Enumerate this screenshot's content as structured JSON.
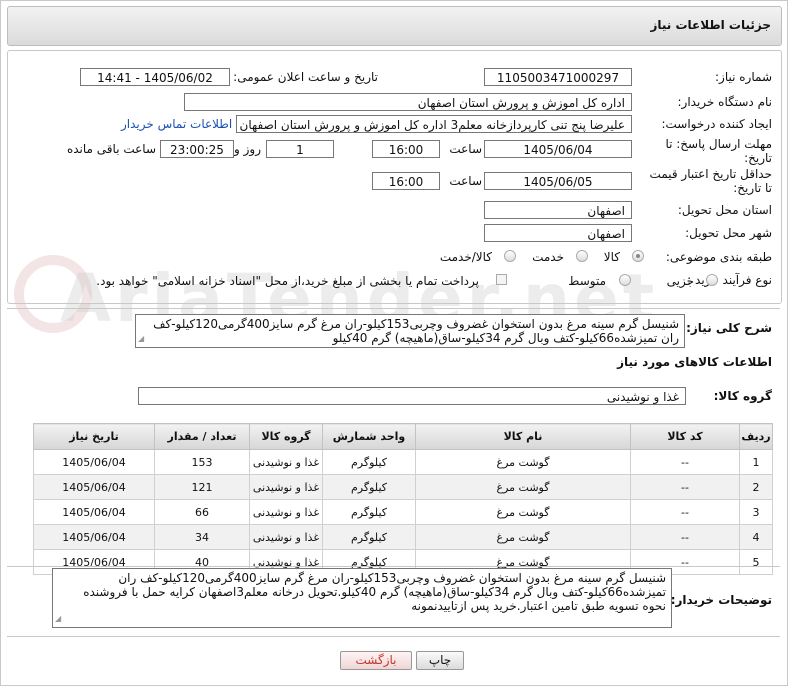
{
  "header": {
    "title": "جزئیات اطلاعات نیاز"
  },
  "form": {
    "need_number_label": "شماره نیاز:",
    "need_number": "1105003471000297",
    "announce_label": "تاریخ و ساعت اعلان عمومی:",
    "announce_value": "1405/06/02 - 14:41",
    "buyer_org_label": "نام دستگاه خریدار:",
    "buyer_org": "اداره کل اموزش و پرورش استان اصفهان",
    "requester_label": "ایجاد کننده درخواست:",
    "requester": "علیرضا پنج تنی کارپردازخانه معلم3 اداره کل اموزش و پرورش استان اصفهان",
    "contact_link": "اطلاعات تماس خریدار",
    "deadline_label_1": "مهلت ارسال پاسخ: تا",
    "deadline_label_2": "تاریخ:",
    "deadline_date": "1405/06/04",
    "time_label": "ساعت",
    "deadline_time": "16:00",
    "days_value": "1",
    "days_label": "روز و",
    "remaining_time": "23:00:25",
    "remaining_label": "ساعت باقی مانده",
    "validity_label_1": "حداقل تاریخ اعتبار قیمت",
    "validity_label_2": "تا تاریخ:",
    "validity_date": "1405/06/05",
    "validity_time": "16:00",
    "province_label": "استان محل تحویل:",
    "province": "اصفهان",
    "city_label": "شهر محل تحویل:",
    "city": "اصفهان",
    "category_label": "طبقه بندی موضوعی:",
    "category_options": [
      "کالا",
      "خدمت",
      "کالا/خدمت"
    ],
    "category_selected": "کالا",
    "process_label": "نوع فرآیند خرید :",
    "process_options": [
      "جزیی",
      "متوسط"
    ],
    "payment_note": "پرداخت تمام یا بخشی از مبلغ خرید،از محل \"اسناد خزانه اسلامی\" خواهد بود."
  },
  "description": {
    "label": "شرح کلی نیاز:",
    "text": "شنیسل گرم سینه مرغ بدون استخوان غضروف وچربی153کیلو-ران مرغ گرم سایز400گرمی120کیلو-کف ران تمیزشده66کیلو-کتف وبال گرم 34کیلو-ساق(ماهیچه) گرم 40کیلو"
  },
  "goods": {
    "section_title": "اطلاعات کالاهای مورد نیاز",
    "group_label": "گروه کالا:",
    "group_value": "غذا و نوشیدنی",
    "columns": [
      "ردیف",
      "کد کالا",
      "نام کالا",
      "واحد شمارش",
      "گروه کالا",
      "تعداد / مقدار",
      "تاریخ نیاز"
    ],
    "rows": [
      [
        "1",
        "--",
        "گوشت مرغ",
        "کیلوگرم",
        "غذا و نوشیدنی",
        "153",
        "1405/06/04"
      ],
      [
        "2",
        "--",
        "گوشت مرغ",
        "کیلوگرم",
        "غذا و نوشیدنی",
        "121",
        "1405/06/04"
      ],
      [
        "3",
        "--",
        "گوشت مرغ",
        "کیلوگرم",
        "غذا و نوشیدنی",
        "66",
        "1405/06/04"
      ],
      [
        "4",
        "--",
        "گوشت مرغ",
        "کیلوگرم",
        "غذا و نوشیدنی",
        "34",
        "1405/06/04"
      ],
      [
        "5",
        "--",
        "گوشت مرغ",
        "کیلوگرم",
        "غذا و نوشیدنی",
        "40",
        "1405/06/04"
      ]
    ]
  },
  "buyer_notes": {
    "label": "توضیحات خریدار:",
    "text": "شنیسل گرم سینه مرغ بدون استخوان غضروف وچربی153کیلو-ران مرغ گرم سایز400گرمی120کیلو-کف ران تمیزشده66کیلو-کتف وبال گرم 34کیلو-ساق(ماهیچه) گرم 40کیلو.تحویل درخانه معلم3اصفهان کرایه حمل با فروشنده نحوه تسویه طبق تامین اعتبار.خرید پس ازتاییدنمونه"
  },
  "buttons": {
    "print": "چاپ",
    "back": "بازگشت"
  },
  "colors": {
    "link": "#1a4fb4",
    "header_bg": "#e4e4e4",
    "back_text": "#c0392b"
  }
}
